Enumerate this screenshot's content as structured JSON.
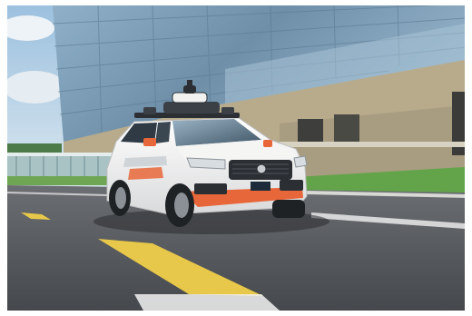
{
  "image": {
    "subject": "self-driving-suv-with-roof-sensors",
    "colors": {
      "sky": "#b9d3e6",
      "cloud": "#eef3f7",
      "glass": "#7f9fb8",
      "glass_dark": "#5f7f98",
      "building_base": "#b7ab8c",
      "road": "#5a5d61",
      "lane_yellow": "#e8c84a",
      "lane_white": "#f2f2f2",
      "grass": "#63a44a",
      "car_body": "#f1f1ef",
      "car_accent": "#e8673a",
      "car_dark": "#2b2f34"
    }
  }
}
